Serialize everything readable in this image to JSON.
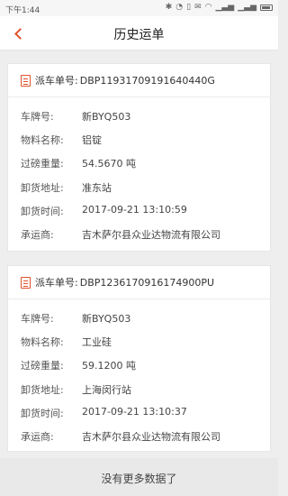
{
  "status_bar": {
    "time": "下午1:44",
    "icons": [
      "bluetooth-icon",
      "alarm-icon",
      "vibrate-icon",
      "mail-icon",
      "wifi-icon",
      "signal-icon",
      "signal-icon",
      "battery-icon"
    ]
  },
  "nav": {
    "title": "历史运单",
    "back_icon": "chevron-left-icon"
  },
  "orders": [
    {
      "dispatch_label": "派车单号:",
      "dispatch_no": "DBP11931709191640440G",
      "fields": [
        {
          "label": "车牌号:",
          "value": "新BYQ503"
        },
        {
          "label": "物料名称:",
          "value": "铝锭"
        },
        {
          "label": "过磅重量:",
          "value": "54.5670 吨"
        },
        {
          "label": "卸货地址:",
          "value": "准东站"
        },
        {
          "label": "卸货时间:",
          "value": "2017-09-21 13:10:59"
        },
        {
          "label": "承运商:",
          "value": "吉木萨尔县众业达物流有限公司"
        }
      ]
    },
    {
      "dispatch_label": "派车单号:",
      "dispatch_no": "DBP1236170916174900PU",
      "fields": [
        {
          "label": "车牌号:",
          "value": "新BYQ503"
        },
        {
          "label": "物料名称:",
          "value": "工业硅"
        },
        {
          "label": "过磅重量:",
          "value": "59.1200 吨"
        },
        {
          "label": "卸货地址:",
          "value": "上海闵行站"
        },
        {
          "label": "卸货时间:",
          "value": "2017-09-21 13:10:37"
        },
        {
          "label": "承运商:",
          "value": "吉木萨尔县众业达物流有限公司"
        }
      ]
    }
  ],
  "footer": {
    "text": "没有更多数据了"
  },
  "colors": {
    "accent": "#e0532d"
  }
}
